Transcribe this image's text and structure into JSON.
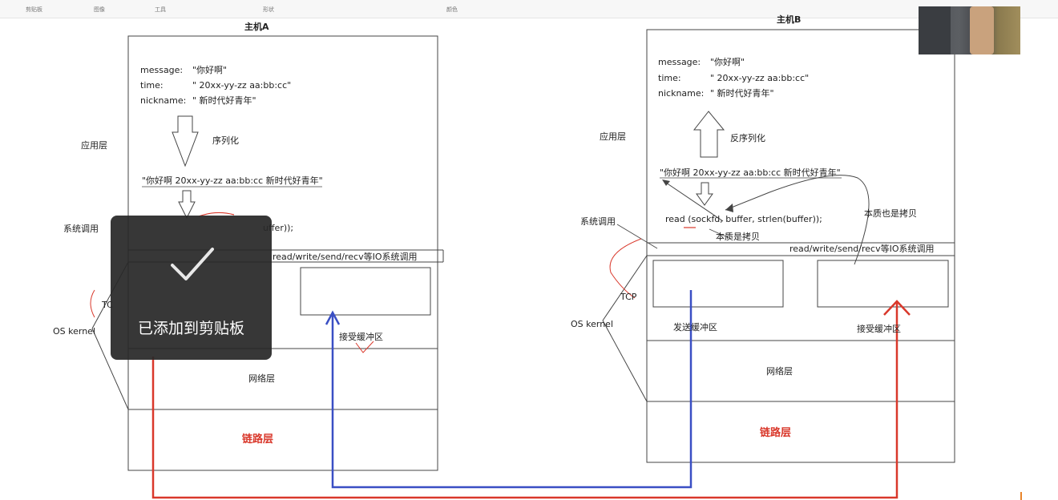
{
  "ribbon": {
    "clipboard": "剪贴板",
    "image": "图像",
    "tools": "工具",
    "shapes": "形状",
    "colors": "颜色"
  },
  "hostA": {
    "title": "主机A",
    "message_label": "message:",
    "message_value": "\"你好啊\"",
    "time_label": "time:",
    "time_value": "\" 20xx-yy-zz aa:bb:cc\"",
    "nickname_label": "nickname:",
    "nickname_value": "\" 新时代好青年\"",
    "serialize": "序列化",
    "app_layer": "应用层",
    "serialized_string": "\"你好啊 20xx-yy-zz aa:bb:cc 新时代好青年\"",
    "syscall_label": "系统调用",
    "call_fragment": "uffer));",
    "io_syscalls": "read/write/send/recv等IO系统调用",
    "tcp": "TC",
    "os_kernel": "OS kernel",
    "recv_buffer": "接受缓冲区",
    "network_layer": "网络层",
    "link_layer": "链路层"
  },
  "hostB": {
    "title": "主机B",
    "message_label": "message:",
    "message_value": "\"你好啊\"",
    "time_label": "time:",
    "time_value": "\" 20xx-yy-zz aa:bb:cc\"",
    "nickname_label": "nickname:",
    "nickname_value": "\" 新时代好青年\"",
    "deserialize": "反序列化",
    "app_layer": "应用层",
    "serialized_string": "\"你好啊 20xx-yy-zz aa:bb:cc 新时代好青年\"",
    "read_call": "read (sockfd, buffer, strlen(buffer));",
    "syscall_label": "系统调用",
    "copy_note_1": "本质也是拷贝",
    "copy_note_2": "本质是拷贝",
    "io_syscalls": "read/write/send/recv等IO系统调用",
    "tcp": "TCP",
    "os_kernel": "OS kernel",
    "send_buffer": "发送缓冲区",
    "recv_buffer": "接受缓冲区",
    "network_layer": "网络层",
    "link_layer": "链路层"
  },
  "toast": {
    "message": "已添加到剪贴板",
    "icon": "checkmark-icon"
  },
  "colors": {
    "red_arrow": "#d9382b",
    "blue_arrow": "#3a4fc4",
    "link_text": "#d9382b",
    "toast_bg": "#282828"
  }
}
